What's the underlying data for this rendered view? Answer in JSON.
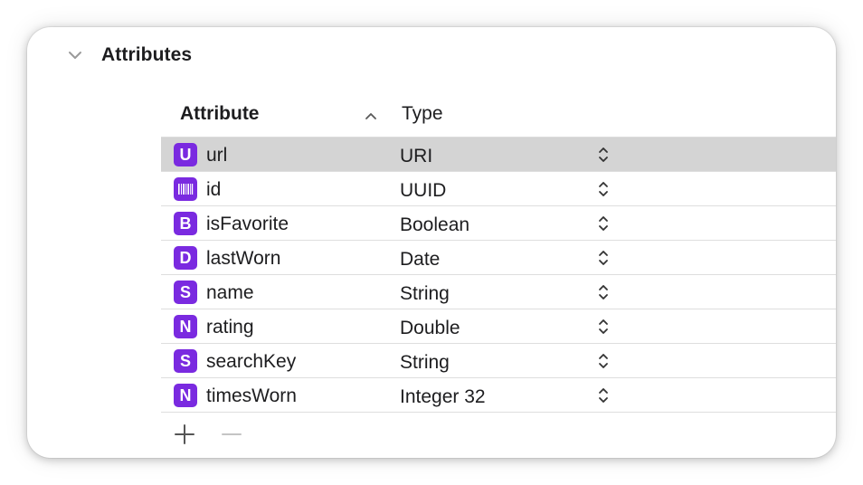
{
  "section": {
    "title": "Attributes",
    "expanded": true,
    "chevron_icon": "chevron-down-icon"
  },
  "table": {
    "columns": {
      "attribute": "Attribute",
      "type": "Type"
    },
    "sort": {
      "column": "attribute",
      "direction": "ascending",
      "icon": "chevron-up-icon"
    },
    "rows": [
      {
        "badge": "U",
        "badge_kind": "letter",
        "name": "url",
        "type": "URI",
        "selected": true
      },
      {
        "badge": "",
        "badge_kind": "barcode-icon",
        "name": "id",
        "type": "UUID",
        "selected": false
      },
      {
        "badge": "B",
        "badge_kind": "letter",
        "name": "isFavorite",
        "type": "Boolean",
        "selected": false
      },
      {
        "badge": "D",
        "badge_kind": "letter",
        "name": "lastWorn",
        "type": "Date",
        "selected": false
      },
      {
        "badge": "S",
        "badge_kind": "letter",
        "name": "name",
        "type": "String",
        "selected": false
      },
      {
        "badge": "N",
        "badge_kind": "letter",
        "name": "rating",
        "type": "Double",
        "selected": false
      },
      {
        "badge": "S",
        "badge_kind": "letter",
        "name": "searchKey",
        "type": "String",
        "selected": false
      },
      {
        "badge": "N",
        "badge_kind": "letter",
        "name": "timesWorn",
        "type": "Integer 32",
        "selected": false
      }
    ]
  },
  "footer": {
    "add_icon": "plus-icon",
    "remove_icon": "minus-icon",
    "remove_enabled": false
  },
  "colors": {
    "badge": "#7a2ae0",
    "selected_row": "#d4d4d4",
    "text": "#1d1d1f"
  }
}
